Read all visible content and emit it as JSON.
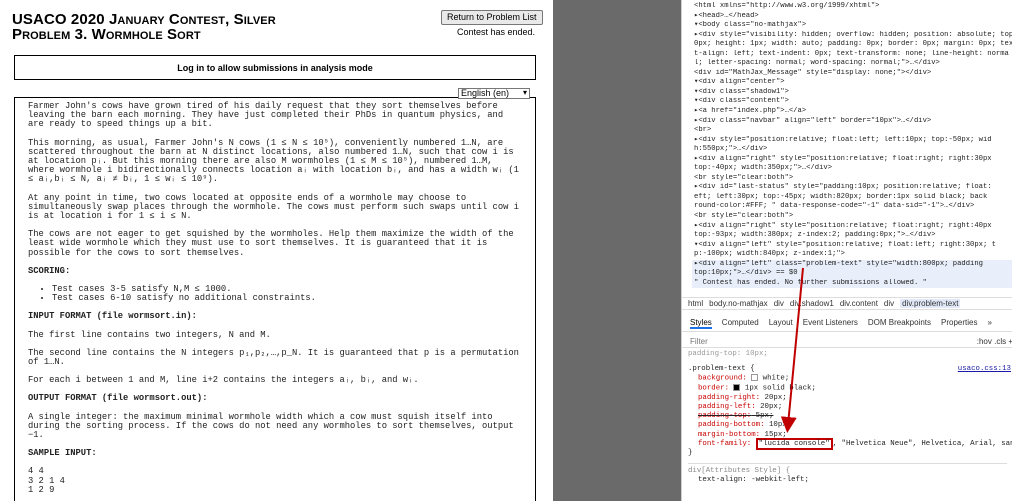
{
  "problem": {
    "contest_line": "USACO 2020 January Contest, Silver",
    "title_line": "Problem 3. Wormhole Sort",
    "return_button": "Return to Problem List",
    "status": "Contest has ended.",
    "login_text": "Log in to allow submissions in analysis mode",
    "language": "English (en)",
    "paragraphs": [
      "Farmer John's cows have grown tired of his daily request that they sort themselves before leaving the barn each morning. They have just completed their PhDs in quantum physics, and are ready to speed things up a bit.",
      "This morning, as usual, Farmer John's N cows (1 ≤ N ≤ 10⁵), conveniently numbered 1…N, are scattered throughout the barn at N distinct locations, also numbered 1…N, such that cow i is at location pᵢ. But this morning there are also M wormholes (1 ≤ M ≤ 10⁵), numbered 1…M, where wormhole i bidirectionally connects location aᵢ with location bᵢ, and has a width wᵢ (1 ≤ aᵢ,bᵢ ≤ N, aᵢ ≠ bᵢ, 1 ≤ wᵢ ≤ 10⁹).",
      "At any point in time, two cows located at opposite ends of a wormhole may choose to simultaneously swap places through the wormhole. The cows must perform such swaps until cow i is at location i for 1 ≤ i ≤ N.",
      "The cows are not eager to get squished by the wormholes. Help them maximize the width of the least wide wormhole which they must use to sort themselves. It is guaranteed that it is possible for the cows to sort themselves."
    ],
    "scoring_head": "SCORING:",
    "scoring_items": [
      "Test cases 3-5 satisfy N,M ≤ 1000.",
      "Test cases 6-10 satisfy no additional constraints."
    ],
    "input_head": "INPUT FORMAT (file wormsort.in):",
    "input_paras": [
      "The first line contains two integers, N and M.",
      "The second line contains the N integers p₁,p₂,…,p_N. It is guaranteed that p is a permutation of 1…N.",
      "For each i between 1 and M, line i+2 contains the integers aᵢ, bᵢ, and wᵢ."
    ],
    "output_head": "OUTPUT FORMAT (file wormsort.out):",
    "output_para": "A single integer: the maximum minimal wormhole width which a cow must squish itself into during the sorting process. If the cows do not need any wormholes to sort themselves, output −1.",
    "sample_head": "SAMPLE INPUT:",
    "sample_lines": [
      "4 4",
      "3 2 1 4",
      "1 2 9"
    ]
  },
  "devtools": {
    "dom_lines": [
      "<html xmlns=\"http://www.w3.org/1999/xhtml\">",
      "▸<head>…</head>",
      "▾<body class=\"no-mathjax\">",
      "  ▸<div style=\"visibility: hidden; overflow: hidden; position: absolute; top:",
      "   0px; height: 1px; width: auto; padding: 0px; border: 0px; margin: 0px; tex",
      "   t-align: left; text-indent: 0px; text-transform: none; line-height: norma",
      "   l; letter-spacing: normal; word-spacing: normal;\">…</div>",
      "   <div id=\"MathJax_Message\" style=\"display: none;\"></div>",
      "  ▾<div align=\"center\">",
      "    ▾<div class=\"shadow1\">",
      "      ▾<div class=\"content\">",
      "        ▸<a href=\"index.php\">…</a>",
      "        ▸<div class=\"navbar\" align=\"left\" border=\"10px\">…</div>",
      "         <br>",
      "        ▸<div style=\"position:relative; float:left; left:10px; top:-50px; wid",
      "         h:550px;\">…</div>",
      "        ▸<div align=\"right\" style=\"position:relative; float:right; right:30px",
      "         top:-40px; width:350px;\">…</div>",
      "         <br style=\"clear:both\">",
      "        ▸<div id=\"last-status\" style=\"padding:10px; position:relative; float:",
      "         eft; left:30px; top:-45px; width:820px; border:1px solid black; back",
      "         round-color:#FFF; \" data-response-code=\"-1\" data-sid=\"-1\">…</div>",
      "         <br style=\"clear:both\">",
      "        ▸<div align=\"right\" style=\"position:relative; float:right; right:40px",
      "         top:-93px; width:380px; z-index:2; padding:0px;\">…</div>",
      "        ▾<div align=\"left\" style=\"position:relative; float:left; right:30px; t",
      "         p:-100px; width:840px; z-index:1;\">",
      "          ▸<div align=\"left\" class=\"problem-text\" style=\"width:800px; padding",
      "           top:10px;\">…</div> == $0",
      "           \" Contest has ended. No further submissions allowed. \""
    ],
    "breadcrumbs": [
      "html",
      "body.no-mathjax",
      "div",
      "div.shadow1",
      "div.content",
      "div",
      "div.problem-text"
    ],
    "tabs": [
      "Styles",
      "Computed",
      "Layout",
      "Event Listeners",
      "DOM Breakpoints",
      "Properties",
      "»"
    ],
    "filter_placeholder": "Filter",
    "filter_tools": ":hov  .cls  +",
    "partial_line": "padding-top: 10px;",
    "selector": ".problem-text {",
    "source": "usaco.css:13",
    "rules": [
      {
        "p": "background:",
        "v": "white;",
        "strike": false
      },
      {
        "p": "border:",
        "v": "1px solid black;",
        "strike": false
      },
      {
        "p": "padding-right:",
        "v": "20px;",
        "strike": false
      },
      {
        "p": "padding-left:",
        "v": "20px;",
        "strike": false
      },
      {
        "p": "padding-top:",
        "v": "5px;",
        "strike": true
      },
      {
        "p": "padding-bottom:",
        "v": "10px;",
        "strike": false
      },
      {
        "p": "margin-bottom:",
        "v": "15px;",
        "strike": false
      }
    ],
    "font_family_prop": "font-family:",
    "font_family_first": "\"lucida console\"",
    "font_family_rest": "\"Helvetica Neue\", Helvetica, Arial, sans-serif",
    "close_brace": "}",
    "attr_style": "div[Attributes Style] {",
    "attr_rule": "text-align: -webkit-left;"
  }
}
